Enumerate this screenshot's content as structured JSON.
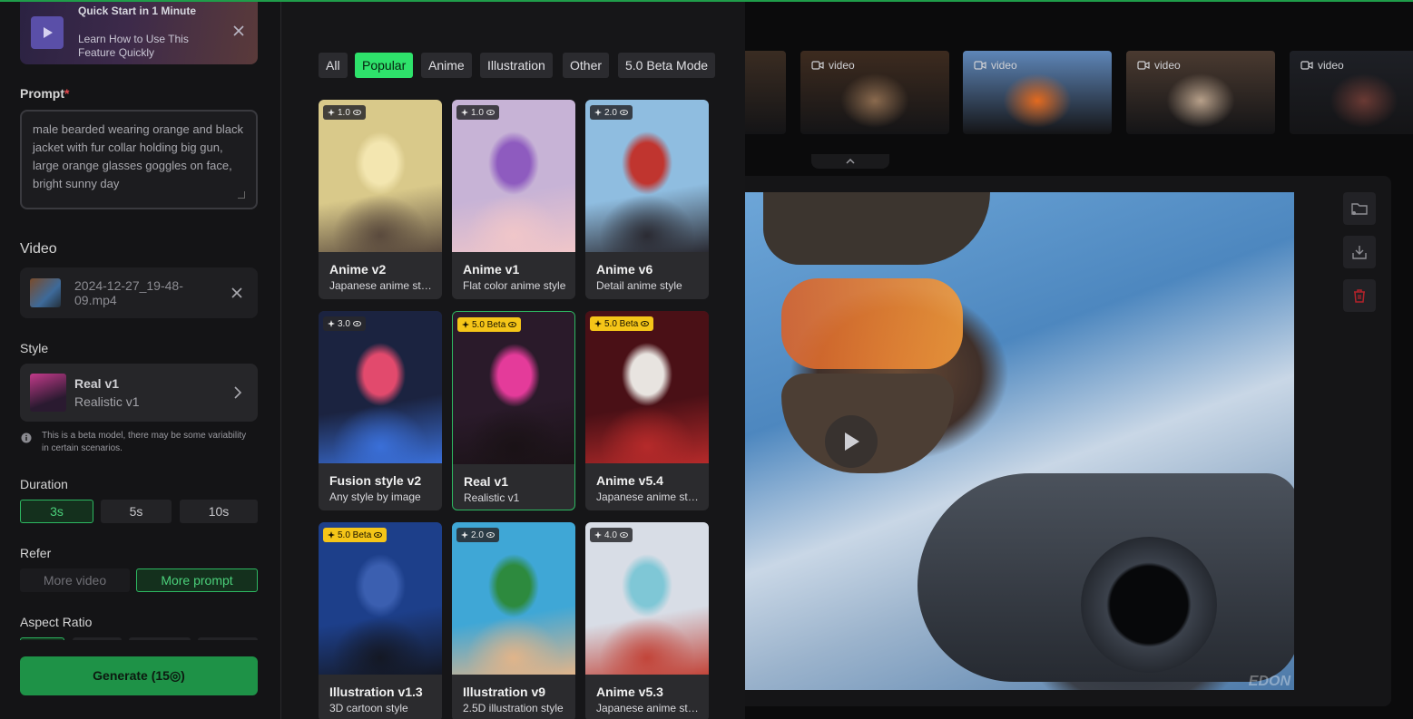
{
  "quick_start": {
    "title": "Quick Start in 1 Minute",
    "subtitle": "Learn How to Use This Feature Quickly"
  },
  "prompt": {
    "label": "Prompt",
    "required_mark": "*",
    "value": "male bearded  wearing orange and black jacket with fur collar holding big gun, large orange glasses goggles on face, bright sunny day"
  },
  "video": {
    "label": "Video",
    "file_name": "2024-12-27_19-48-09.mp4"
  },
  "style": {
    "label": "Style",
    "selected_name": "Real v1",
    "selected_sub": "Realistic v1",
    "beta_notice": "This is a beta model, there may be some variability in certain scenarios."
  },
  "duration": {
    "label": "Duration",
    "options": [
      "3s",
      "5s",
      "10s"
    ],
    "selected": "3s"
  },
  "refer": {
    "label": "Refer",
    "options": [
      "More video",
      "More prompt"
    ],
    "selected": "More prompt"
  },
  "aspect_ratio": {
    "label": "Aspect Ratio"
  },
  "generate": {
    "label": "Generate (15◎)"
  },
  "picker": {
    "tabs": [
      "All",
      "Popular",
      "Anime",
      "Illustration",
      "Other",
      "5.0 Beta Mode"
    ],
    "active_tab": "Popular",
    "cards": [
      {
        "version": "1.0",
        "title": "Anime v2",
        "sub": "Japanese anime style",
        "beta": false,
        "colors": [
          "#d9c98a",
          "#f3e6b0",
          "#5a4a3d"
        ]
      },
      {
        "version": "1.0",
        "title": "Anime v1",
        "sub": "Flat color anime style",
        "beta": false,
        "colors": [
          "#c7b3d6",
          "#8e5bbf",
          "#f0c6c9"
        ]
      },
      {
        "version": "2.0",
        "title": "Anime v6",
        "sub": "Detail anime style",
        "beta": false,
        "colors": [
          "#8fbde0",
          "#c0352f",
          "#2b2b33"
        ]
      },
      {
        "version": "3.0",
        "title": "Fusion style v2",
        "sub": "Any style by image",
        "beta": false,
        "colors": [
          "#1b2340",
          "#e24a6d",
          "#3a6fd8"
        ]
      },
      {
        "version": "5.0 Beta",
        "title": "Real v1",
        "sub": "Realistic v1",
        "beta": true,
        "selected": true,
        "colors": [
          "#2a1a2a",
          "#e43b9a",
          "#1a1216"
        ]
      },
      {
        "version": "5.0 Beta",
        "title": "Anime v5.4",
        "sub": "Japanese anime style",
        "beta": true,
        "colors": [
          "#4a1016",
          "#e8e4e0",
          "#b52a2a"
        ]
      },
      {
        "version": "5.0 Beta",
        "title": "Illustration v1.3",
        "sub": "3D cartoon style",
        "beta": true,
        "colors": [
          "#1d3f8a",
          "#3b5fb0",
          "#141824"
        ]
      },
      {
        "version": "2.0",
        "title": "Illustration v9",
        "sub": "2.5D illustration style",
        "beta": false,
        "colors": [
          "#3fa7d6",
          "#2d8a3e",
          "#e0b48a"
        ]
      },
      {
        "version": "4.0",
        "title": "Anime v5.3",
        "sub": "Japanese anime style",
        "beta": false,
        "colors": [
          "#d8dde6",
          "#7fc7d6",
          "#c2453a"
        ]
      }
    ]
  },
  "strip": {
    "label": "video",
    "items": [
      {
        "colors": [
          "#3a2c22",
          "#6b5240"
        ]
      },
      {
        "colors": [
          "#3d2b1f",
          "#8a6a4e"
        ]
      },
      {
        "colors": [
          "#5e86b8",
          "#e36a1f"
        ]
      },
      {
        "colors": [
          "#4a3a30",
          "#b7a08a"
        ]
      },
      {
        "colors": [
          "#1e2026",
          "#6a3a34"
        ]
      }
    ]
  },
  "preview": {
    "watermark": "EDON"
  }
}
